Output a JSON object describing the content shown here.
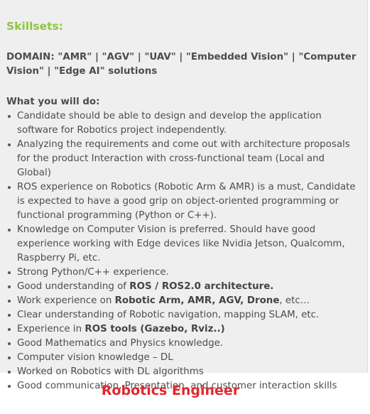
{
  "heading": "Skillsets:",
  "domain": "DOMAIN: \"AMR\" | \"AGV\" | \"UAV\" | \"Embedded Vision\" | \"Computer Vision\" | \"Edge AI\" solutions",
  "what_you_will_do": "What you will do:",
  "items": [
    {
      "text": "Candidate should be able to design and develop the application software for Robotics project independently."
    },
    {
      "text": "Analyzing the requirements and come out with architecture proposals for the product Interaction with cross-functional team (Local and Global)"
    },
    {
      "text": "ROS experience on Robotics (Robotic Arm & AMR) is a must, Candidate is expected to have a good grip on object-oriented programming or functional programming (Python or C++)."
    },
    {
      "text": "Knowledge on Computer Vision is preferred. Should have good experience working with Edge devices like Nvidia Jetson, Qualcomm, Raspberry Pi, etc."
    },
    {
      "text": "Strong Python/C++ experience."
    },
    {
      "pre": "Good understanding of ",
      "bold": "ROS / ROS2.0 architecture.",
      "post": ""
    },
    {
      "pre": "Work experience on ",
      "bold": "Robotic Arm, AMR, AGV, Drone",
      "post": ", etc…"
    },
    {
      "text": "Clear understanding of Robotic navigation, mapping SLAM, etc."
    },
    {
      "pre": "Experience in ",
      "bold": "ROS tools (Gazebo, Rviz..)",
      "post": ""
    },
    {
      "text": "Good Mathematics and Physics knowledge."
    },
    {
      "text": "Computer vision knowledge – DL"
    },
    {
      "text": "Worked on Robotics with DL algorithms"
    },
    {
      "text": "Good communication, Presentation, and customer interaction skills"
    }
  ],
  "footer_title": "Robotics Engineer",
  "colors": {
    "heading": "#8dc63f",
    "footer": "#e0282e",
    "panel_bg": "#efefef"
  }
}
